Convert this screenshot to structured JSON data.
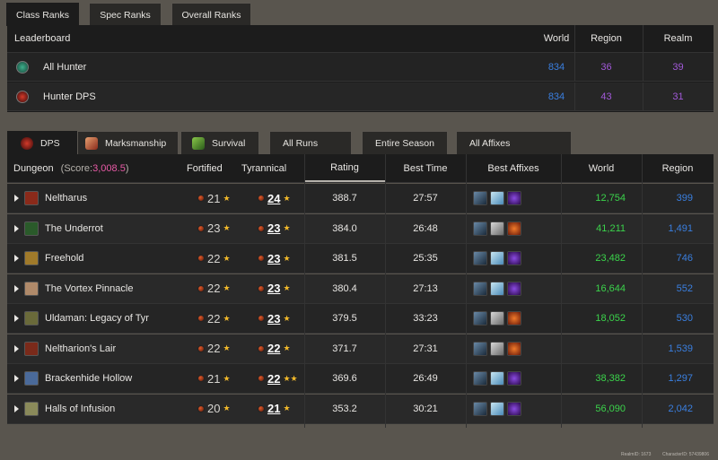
{
  "top_tabs": [
    {
      "label": "Class Ranks",
      "active": true
    },
    {
      "label": "Spec Ranks",
      "active": false
    },
    {
      "label": "Overall Ranks",
      "active": false
    }
  ],
  "leaderboard": {
    "headers": {
      "name": "Leaderboard",
      "world": "World",
      "region": "Region",
      "realm": "Realm"
    },
    "rows": [
      {
        "icon": "hunter-class-icon",
        "name": "All Hunter",
        "world": "834",
        "region": "36",
        "realm": "39"
      },
      {
        "icon": "hunter-dps-icon",
        "name": "Hunter DPS",
        "world": "834",
        "region": "43",
        "realm": "31"
      }
    ]
  },
  "spec_tabs": [
    {
      "label": "DPS",
      "active": true
    },
    {
      "label": "Marksmanship",
      "active": false
    },
    {
      "label": "Survival",
      "active": false
    }
  ],
  "filter_tabs": [
    {
      "label": "All Runs"
    },
    {
      "label": "Entire Season"
    },
    {
      "label": "All Affixes"
    }
  ],
  "dungeons": {
    "headers": {
      "dungeon": "Dungeon",
      "score_prefix": "(Score: ",
      "score": "3,008.5",
      "score_suffix": ")",
      "fortified": "Fortified",
      "tyrannical": "Tyrannical",
      "rating": "Rating",
      "best_time": "Best Time",
      "best_affixes": "Best Affixes",
      "world": "World",
      "region": "Region"
    },
    "rows": [
      {
        "name": "Neltharus",
        "fortified": "21",
        "fort_stars": "★",
        "tyrannical": "24",
        "tyr_stars": "★",
        "rating": "388.7",
        "time": "27:57",
        "affixes": [
          "a1",
          "a2",
          "a3"
        ],
        "world": "12,754",
        "region": "399",
        "icon_color": "#8a2a1a"
      },
      {
        "name": "The Underrot",
        "fortified": "23",
        "fort_stars": "★",
        "tyrannical": "23",
        "tyr_stars": "★",
        "rating": "384.0",
        "time": "26:48",
        "affixes": [
          "a1",
          "a4",
          "a5"
        ],
        "world": "41,211",
        "region": "1,491",
        "icon_color": "#2a5a2a"
      },
      {
        "name": "Freehold",
        "fortified": "22",
        "fort_stars": "★",
        "tyrannical": "23",
        "tyr_stars": "★",
        "rating": "381.5",
        "time": "25:35",
        "affixes": [
          "a1",
          "a2",
          "a3"
        ],
        "world": "23,482",
        "region": "746",
        "icon_color": "#a07a2a"
      },
      {
        "name": "The Vortex Pinnacle",
        "fortified": "22",
        "fort_stars": "★",
        "tyrannical": "23",
        "tyr_stars": "★",
        "rating": "380.4",
        "time": "27:13",
        "affixes": [
          "a1",
          "a2",
          "a3"
        ],
        "world": "16,644",
        "region": "552",
        "icon_color": "#b08a6a"
      },
      {
        "name": "Uldaman: Legacy of Tyr",
        "fortified": "22",
        "fort_stars": "★",
        "tyrannical": "23",
        "tyr_stars": "★",
        "rating": "379.5",
        "time": "33:23",
        "affixes": [
          "a1",
          "a4",
          "a5"
        ],
        "world": "18,052",
        "region": "530",
        "icon_color": "#6a6a3a"
      },
      {
        "name": "Neltharion's Lair",
        "fortified": "22",
        "fort_stars": "★",
        "tyrannical": "22",
        "tyr_stars": "★",
        "rating": "371.7",
        "time": "27:31",
        "affixes": [
          "a1",
          "a4",
          "a5"
        ],
        "world": "",
        "region": "1,539",
        "icon_color": "#7a2a1a"
      },
      {
        "name": "Brackenhide Hollow",
        "fortified": "21",
        "fort_stars": "★",
        "tyrannical": "22",
        "tyr_stars": "★★",
        "rating": "369.6",
        "time": "26:49",
        "affixes": [
          "a1",
          "a2",
          "a3"
        ],
        "world": "38,382",
        "region": "1,297",
        "icon_color": "#4a6a9a"
      },
      {
        "name": "Halls of Infusion",
        "fortified": "20",
        "fort_stars": "★",
        "tyrannical": "21",
        "tyr_stars": "★",
        "rating": "353.2",
        "time": "30:21",
        "affixes": [
          "a1",
          "a2",
          "a3"
        ],
        "world": "56,090",
        "region": "2,042",
        "icon_color": "#8a8a5a"
      }
    ]
  },
  "footer": {
    "realm": "RealmID: 1673",
    "character": "CharacterID: 57439806"
  },
  "colors": {
    "blue": "#3a7fe0",
    "purple": "#a259d9",
    "green": "#3bd34b",
    "star": "#f2b92a"
  }
}
